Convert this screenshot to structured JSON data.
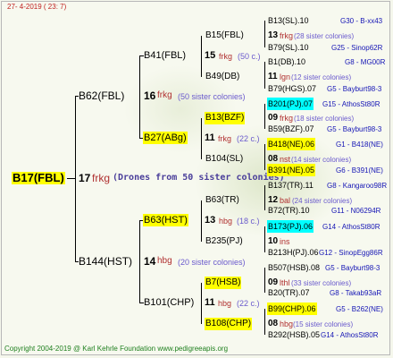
{
  "header": {
    "date": "27-   4-2019  (  23:   7)"
  },
  "footer": {
    "copyright": "Copyright 2004-2019 @ Karl Kehrle Foundation    www.pedigreeapis.org"
  },
  "colors": {
    "yellow": "#ffff00",
    "cyan": "#00ffff",
    "breeder": "#b03030",
    "count": "#6a5acd",
    "ref": "#1515b5",
    "green": "#208020"
  },
  "root": {
    "id": "B17(FBL)",
    "num": "17",
    "breeder": "frkg",
    "colonies": "(Drones from 50 sister colonies)"
  },
  "g1": [
    {
      "id": "B62(FBL)",
      "num": "16",
      "breeder": "frkg",
      "colonies": "(50 sister colonies)"
    },
    {
      "id": "B144(HST)",
      "num": "14",
      "breeder": "hbg",
      "colonies": "(20 sister colonies)"
    }
  ],
  "g2": [
    {
      "id": "B41(FBL)",
      "num": "15",
      "breeder": "frkg",
      "colonies": "(50 c.)"
    },
    {
      "id": "B27(ABg)",
      "num": "11",
      "breeder": "frkg",
      "colonies": "(22 c.)"
    },
    {
      "id": "B63(HST)",
      "num": "13",
      "breeder": "hbg",
      "colonies": "(18 c.)"
    },
    {
      "id": "B101(CHP)",
      "num": "11",
      "breeder": "hbg",
      "colonies": "(22 c.)"
    }
  ],
  "g3": [
    {
      "id": "B15(FBL)",
      "num": "13",
      "breeder": "frkg",
      "colonies": "(28 sister colonies)"
    },
    {
      "id": "B49(DB)",
      "num": "11",
      "breeder": "lgn",
      "colonies": "(12 sister colonies)"
    },
    {
      "id": "B13(BZF)",
      "num": "09",
      "breeder": "frkg",
      "colonies": "(18 sister colonies)"
    },
    {
      "id": "B104(SL)",
      "num": "08",
      "breeder": "nst",
      "colonies": "(14 sister colonies)"
    },
    {
      "id": "B63(TR)",
      "num": "12",
      "breeder": "bal",
      "colonies": "(24 sister colonies)"
    },
    {
      "id": "B235(PJ)",
      "num": "10",
      "breeder": "ins",
      "colonies": ""
    },
    {
      "id": "B7(HSB)",
      "num": "09",
      "breeder": "lthl",
      "colonies": "(33 sister colonies)"
    },
    {
      "id": "B108(CHP)",
      "num": "08",
      "breeder": "hbg",
      "colonies": "(15 sister colonies)"
    }
  ],
  "g4": [
    {
      "id": "B13(SL).10",
      "ref": "G30 - B-xx43"
    },
    {
      "id": "B79(SL).10",
      "ref": "G25 - Sinop62R"
    },
    {
      "id": "B1(DB).10",
      "ref": "G8 - MG00R"
    },
    {
      "id": "B79(HGS).07",
      "ref": "G5 - Bayburt98-3"
    },
    {
      "id": "B201(PJ).07",
      "ref": "G15 - AthosSt80R"
    },
    {
      "id": "B59(BZF).07",
      "ref": "G5 - Bayburt98-3"
    },
    {
      "id": "B418(NE).06",
      "ref": "G1 - B418(NE)"
    },
    {
      "id": "B391(NE).05",
      "ref": "G6 - B391(NE)"
    },
    {
      "id": "B137(TR).11",
      "ref": "G8 - Kangaroo98R"
    },
    {
      "id": "B72(TR).10",
      "ref": "G11 - N06294R"
    },
    {
      "id": "B173(PJ).06",
      "ref": "G14 - AthosSt80R"
    },
    {
      "id": "B213H(PJ).06",
      "ref": "G12 - SinopEgg86R"
    },
    {
      "id": "B507(HSB).08",
      "ref": "G5 - Bayburt98-3"
    },
    {
      "id": "B20(TR).07",
      "ref": "G8 - Takab93aR"
    },
    {
      "id": "B99(CHP).06",
      "ref": "G5 - B262(NE)"
    },
    {
      "id": "B292(HSB).05",
      "ref": "G14 - AthosSt80R"
    }
  ]
}
